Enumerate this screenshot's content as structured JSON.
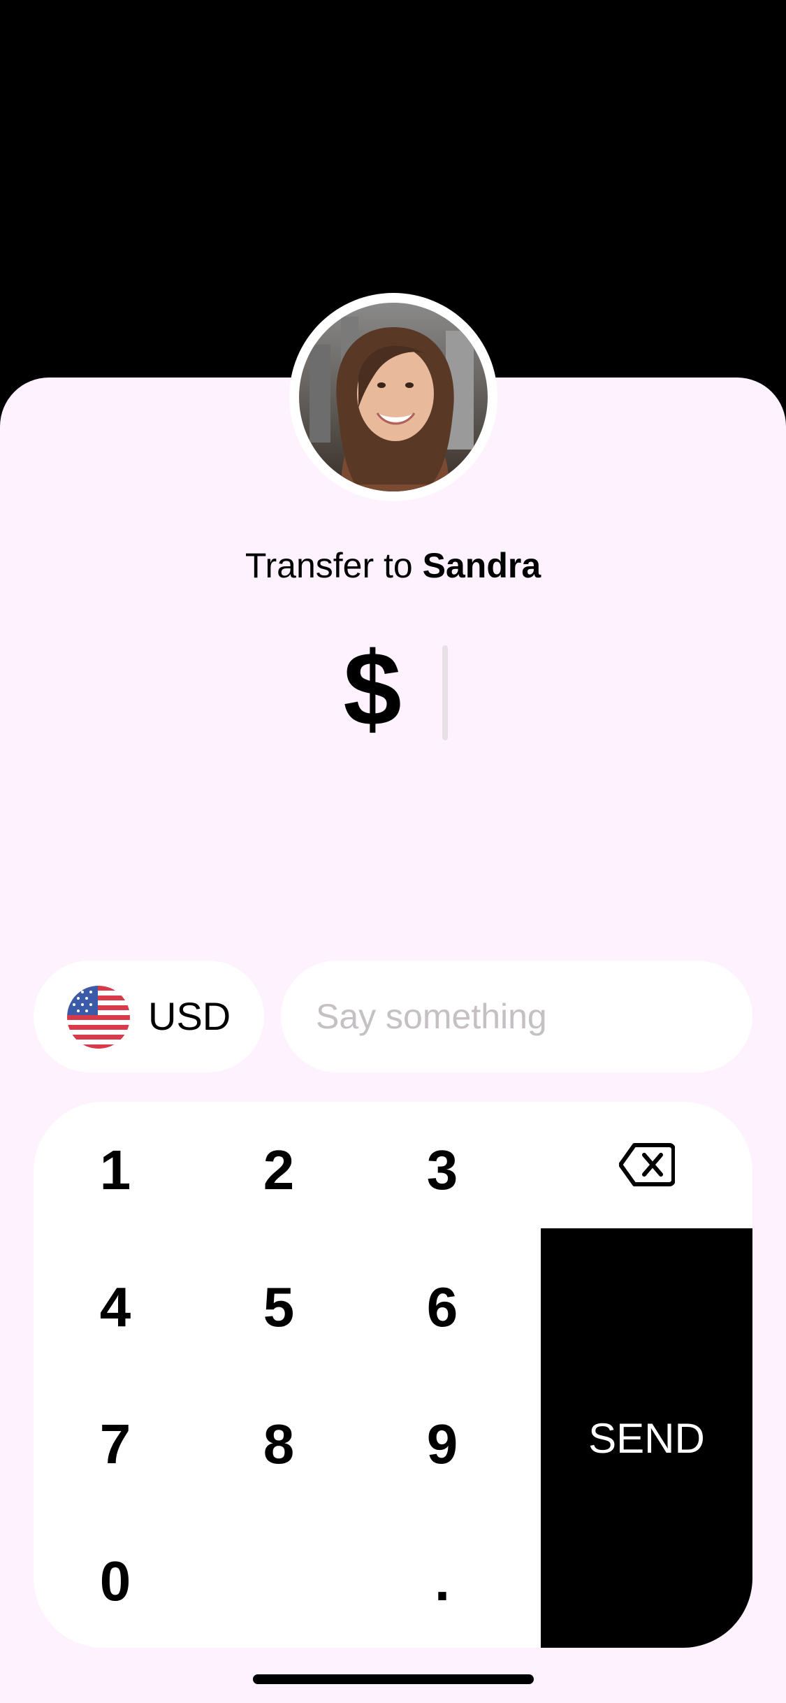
{
  "recipient": {
    "prefix": "Transfer to",
    "name": "Sandra",
    "avatar_icon": "user-photo"
  },
  "amount": {
    "currency_symbol": "$",
    "value": ""
  },
  "currency": {
    "code": "USD",
    "flag_icon": "us-flag-icon"
  },
  "message": {
    "placeholder": "Say something",
    "value": ""
  },
  "keypad": {
    "keys": [
      "1",
      "2",
      "3",
      "4",
      "5",
      "6",
      "7",
      "8",
      "9",
      "0",
      "."
    ],
    "backspace_icon": "backspace-icon",
    "send_label": "SEND"
  },
  "colors": {
    "background": "#000000",
    "sheet": "#FDF2FD",
    "card": "#FFFFFF",
    "accent": "#000000",
    "placeholder": "#C4C0C4"
  }
}
